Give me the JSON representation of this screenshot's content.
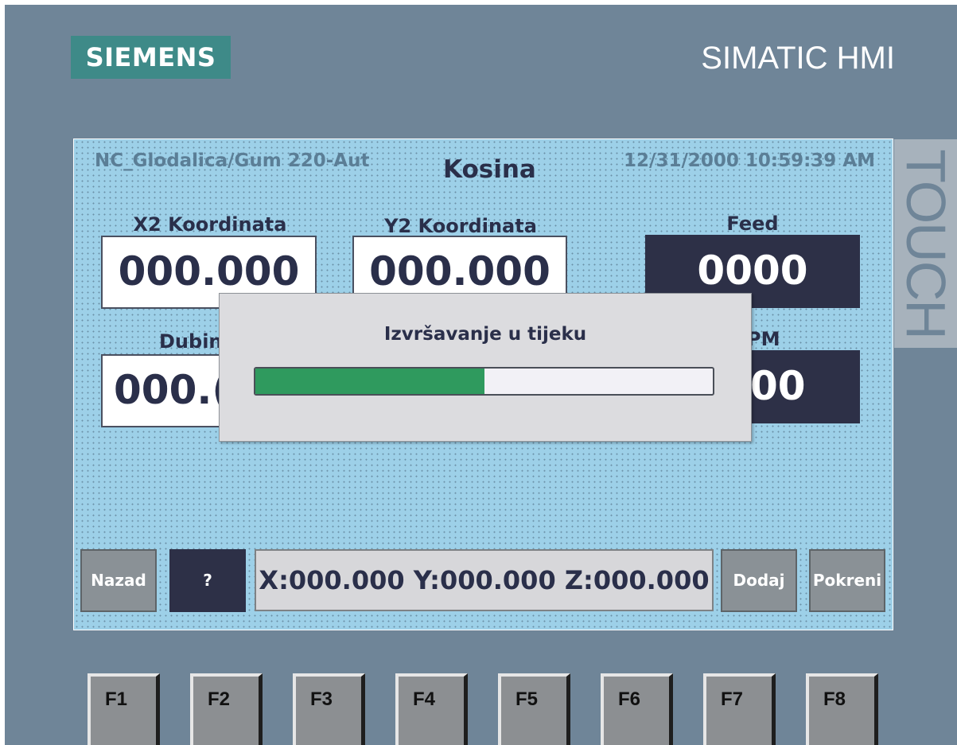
{
  "panel": {
    "brand_logo": "SIEMENS",
    "product_name": "SIMATIC HMI",
    "side_label": "TOUCH",
    "colors": {
      "bezel": "#6f8598",
      "screen": "#9dd0e8",
      "dark_field": "#2d3047",
      "progress_fill": "#2f9a5e",
      "logo_bg": "#3e8a88"
    }
  },
  "screen": {
    "header": {
      "project": "NC_Glodalica/Gum 220-Aut",
      "title": "Kosina",
      "datetime": "12/31/2000 10:59:39 AM"
    },
    "fields": {
      "x2": {
        "label": "X2 Koordinata",
        "value": "000.000"
      },
      "y2": {
        "label": "Y2 Koordinata",
        "value": "000.000"
      },
      "feed": {
        "label": "Feed",
        "value": "0000"
      },
      "dubina": {
        "label": "Dubin",
        "value": "000.("
      },
      "rpm": {
        "label": "PM",
        "value": "00"
      }
    },
    "bottom": {
      "nazad": "Nazad",
      "help": "?",
      "coords": "X:000.000 Y:000.000 Z:000.000",
      "dodaj": "Dodaj",
      "pokreni": "Pokreni"
    },
    "dialog": {
      "message": "Izvršavanje u tijeku",
      "progress_percent": 50
    }
  },
  "function_keys": [
    "F1",
    "F2",
    "F3",
    "F4",
    "F5",
    "F6",
    "F7",
    "F8"
  ]
}
